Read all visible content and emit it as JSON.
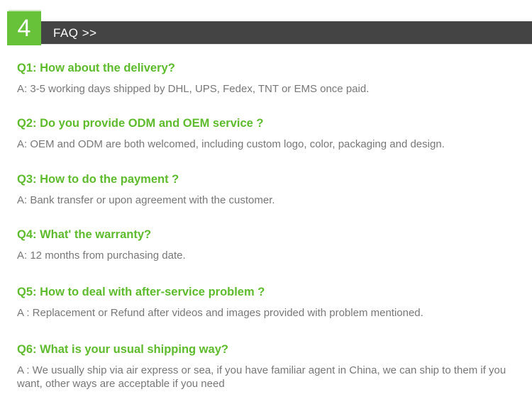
{
  "header": {
    "number": "4",
    "title": "FAQ >>"
  },
  "faqs": [
    {
      "question": "Q1: How about the delivery?",
      "answer": "A: 3-5 working days shipped by DHL, UPS, Fedex, TNT or EMS once paid."
    },
    {
      "question": "Q2: Do you provide ODM and OEM service ?",
      "answer": "A: OEM and ODM are both welcomed, including custom logo, color, packaging and design."
    },
    {
      "question": "Q3: How to do the payment ?",
      "answer": "A: Bank transfer or upon agreement with the customer."
    },
    {
      "question": "Q4: What' the warranty?",
      "answer": "A: 12 months from purchasing date."
    },
    {
      "question": "Q5: How to deal with after-service problem ?",
      "answer": "A : Replacement or Refund after videos and images provided with problem mentioned."
    },
    {
      "question": "Q6: What is your usual shipping way?",
      "answer": "A : We usually ship via air express or sea, if you have familiar agent in China, we can ship to them if you want, other ways are acceptable if you need"
    }
  ],
  "colors": {
    "accent_green": "#67c23a",
    "question_green": "#5dbb2c",
    "header_bar": "#444444",
    "answer_text": "#777777"
  }
}
